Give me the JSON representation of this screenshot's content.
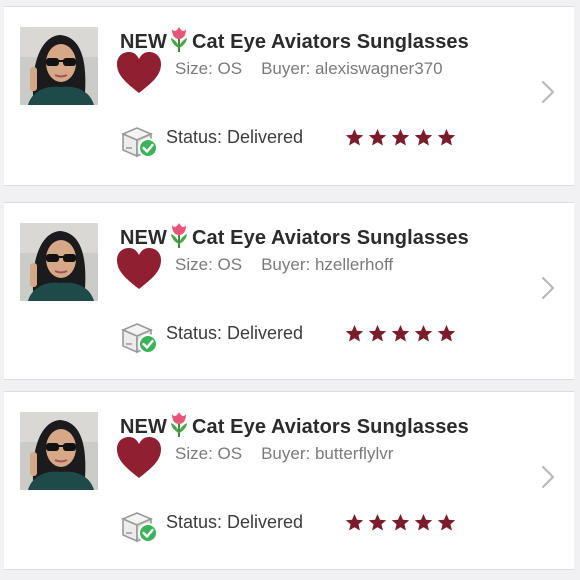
{
  "colors": {
    "accent_maroon": "#7b1c2c",
    "check_green": "#3bb35a",
    "page_background": "#f1f1f3"
  },
  "orders": [
    {
      "title_prefix": "NEW",
      "title_emoji": "tulip-icon",
      "title_text": "Cat Eye Aviators Sunglasses",
      "size_label": "Size:",
      "size_value": "OS",
      "buyer_label": "Buyer:",
      "buyer_value": "alexiswagner370",
      "status_label": "Status:",
      "status_value": "Delivered",
      "rating": 5,
      "liked": true
    },
    {
      "title_prefix": "NEW",
      "title_emoji": "tulip-icon",
      "title_text": "Cat Eye Aviators Sunglasses",
      "size_label": "Size:",
      "size_value": "OS",
      "buyer_label": "Buyer:",
      "buyer_value": "hzellerhoff",
      "status_label": "Status:",
      "status_value": "Delivered",
      "rating": 5,
      "liked": true
    },
    {
      "title_prefix": "NEW",
      "title_emoji": "tulip-icon",
      "title_text": "Cat Eye Aviators Sunglasses",
      "size_label": "Size:",
      "size_value": "OS",
      "buyer_label": "Buyer:",
      "buyer_value": "butterflylvr",
      "status_label": "Status:",
      "status_value": "Delivered",
      "rating": 5,
      "liked": true
    }
  ]
}
